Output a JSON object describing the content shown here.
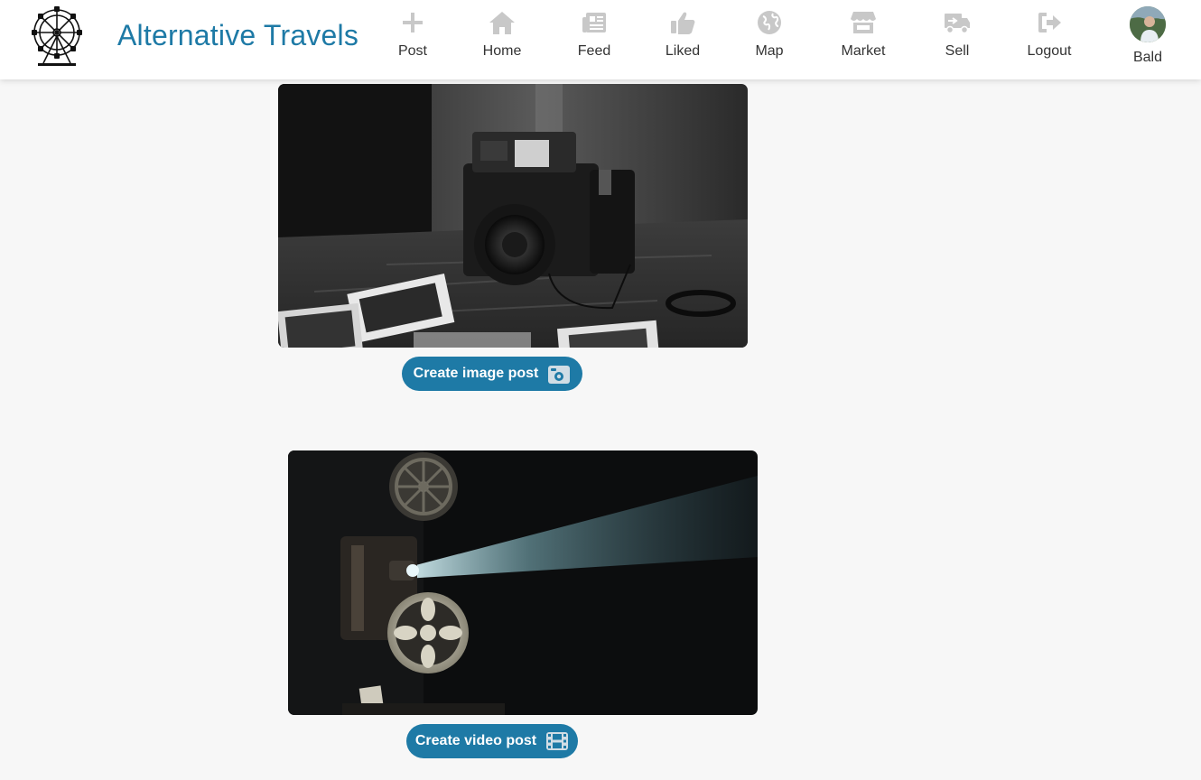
{
  "header": {
    "brand": "Alternative Travels",
    "nav": [
      {
        "label": "Post",
        "icon": "plus-icon"
      },
      {
        "label": "Home",
        "icon": "home-icon"
      },
      {
        "label": "Feed",
        "icon": "newspaper-icon"
      },
      {
        "label": "Liked",
        "icon": "thumbs-up-icon"
      },
      {
        "label": "Map",
        "icon": "globe-icon"
      },
      {
        "label": "Market",
        "icon": "store-icon"
      },
      {
        "label": "Sell",
        "icon": "shipping-truck-icon"
      },
      {
        "label": "Logout",
        "icon": "logout-icon"
      }
    ],
    "user": {
      "label": "Bald",
      "icon": "avatar"
    }
  },
  "cards": [
    {
      "button_label": "Create image post",
      "icon": "camera-icon",
      "image": "polaroid-camera-photo"
    },
    {
      "button_label": "Create video post",
      "icon": "film-icon",
      "image": "film-projector-photo"
    }
  ],
  "colors": {
    "accent": "#1e7aa6",
    "nav_icon": "#c8c8c8",
    "background": "#f7f7f7"
  }
}
